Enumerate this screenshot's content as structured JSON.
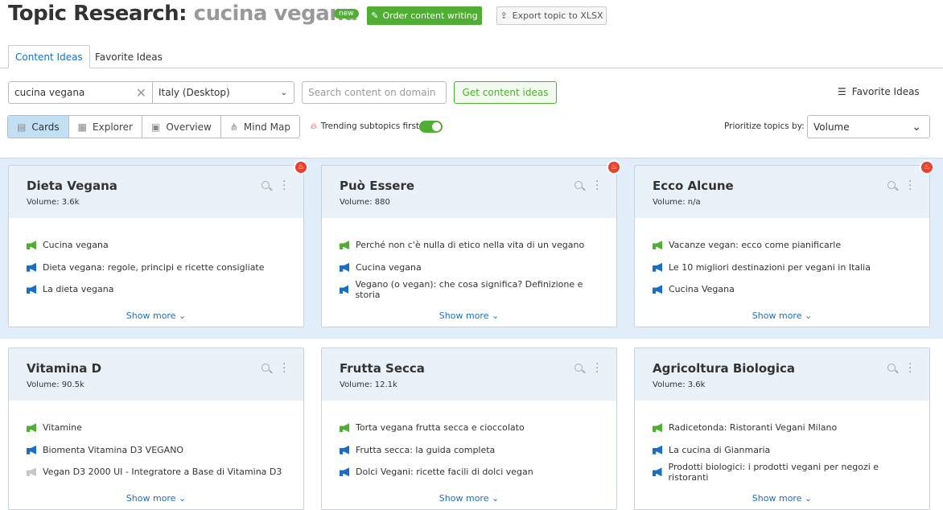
{
  "header": {
    "title": "Topic Research:",
    "keyword": "cucina vegana",
    "badge": "new",
    "order_btn": "Order content writing",
    "export_btn": "Export topic to XLSX"
  },
  "tabs": [
    {
      "label": "Content Ideas",
      "active": true
    },
    {
      "label": "Favorite Ideas",
      "active": false
    }
  ],
  "search": {
    "keyword": "cucina vegana",
    "database": "Italy (Desktop)",
    "domain_placeholder": "Search content on domain",
    "get_btn": "Get content ideas",
    "favorites": "Favorite Ideas"
  },
  "views": [
    {
      "label": "Cards",
      "icon": "cards-icon",
      "active": true
    },
    {
      "label": "Explorer",
      "icon": "table-icon"
    },
    {
      "label": "Overview",
      "icon": "overview-icon"
    },
    {
      "label": "Mind Map",
      "icon": "mindmap-icon"
    }
  ],
  "trending": {
    "label": "Trending subtopics first",
    "on": true
  },
  "prioritize": {
    "label": "Prioritize topics by:",
    "value": "Volume"
  },
  "colors": {
    "high": "#4fae33",
    "medium": "#1a6fc4",
    "low": "#c8c8c8",
    "accent": "#4fae33"
  },
  "show_more": "Show more",
  "cards": [
    {
      "title": "Dieta Vegana",
      "volume": "Volume:  3.6k",
      "trending": true,
      "items": [
        {
          "t": "Cucina vegana",
          "lvl": "high"
        },
        {
          "t": "Dieta vegana: regole, principi e ricette consigliate",
          "lvl": "medium"
        },
        {
          "t": "La dieta vegana",
          "lvl": "medium"
        }
      ]
    },
    {
      "title": "Può Essere",
      "volume": "Volume:  880",
      "trending": true,
      "items": [
        {
          "t": "Perché non c'è nulla di etico nella vita di un vegano",
          "lvl": "high"
        },
        {
          "t": "Cucina vegana",
          "lvl": "medium"
        },
        {
          "t": "Vegano (o vegan): che cosa significa? Definizione e storia",
          "lvl": "medium"
        }
      ]
    },
    {
      "title": "Ecco Alcune",
      "volume": "Volume:  n/a",
      "trending": true,
      "items": [
        {
          "t": "Vacanze vegan: ecco come pianificarle",
          "lvl": "high"
        },
        {
          "t": "Le 10 migliori destinazioni per vegani in Italia",
          "lvl": "medium"
        },
        {
          "t": "Cucina Vegana",
          "lvl": "medium"
        }
      ]
    },
    {
      "title": "Vitamina D",
      "volume": "Volume:  90.5k",
      "trending": false,
      "items": [
        {
          "t": "Vitamine",
          "lvl": "high"
        },
        {
          "t": "Biomenta Vitamina D3 VEGANO",
          "lvl": "medium"
        },
        {
          "t": "Vegan D3 2000 UI - Integratore a Base di Vitamina D3",
          "lvl": "low"
        }
      ]
    },
    {
      "title": "Frutta Secca",
      "volume": "Volume:  12.1k",
      "trending": false,
      "items": [
        {
          "t": "Torta vegana frutta secca e cioccolato",
          "lvl": "high"
        },
        {
          "t": "Frutta secca: la guida completa",
          "lvl": "medium"
        },
        {
          "t": "Dolci Vegani: ricette facili di dolci vegan",
          "lvl": "medium"
        }
      ]
    },
    {
      "title": "Agricoltura Biologica",
      "volume": "Volume:  3.6k",
      "trending": false,
      "items": [
        {
          "t": "Radicetonda: Ristoranti Vegani Milano",
          "lvl": "high"
        },
        {
          "t": "La cucina di Gianmaria",
          "lvl": "medium"
        },
        {
          "t": "Prodotti biologici: i prodotti vegani per negozi e ristoranti",
          "lvl": "medium"
        }
      ]
    }
  ]
}
